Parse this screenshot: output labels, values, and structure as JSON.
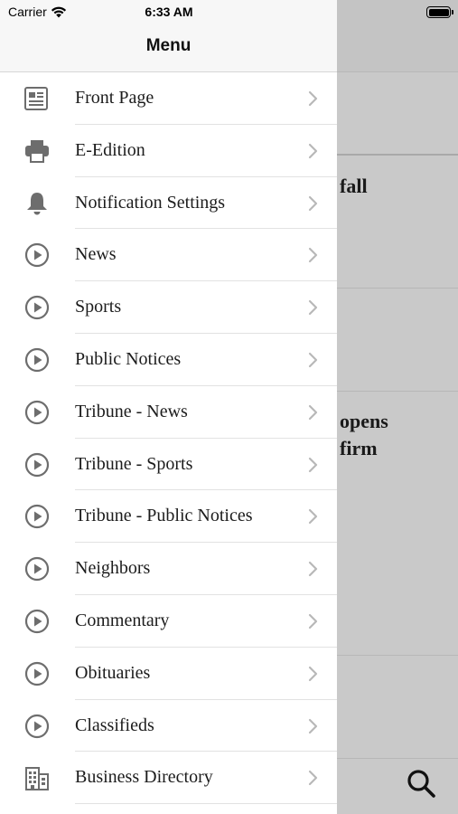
{
  "status_bar": {
    "carrier": "Carrier",
    "time": "6:33 AM"
  },
  "menu": {
    "title": "Menu",
    "items": [
      {
        "label": "Front Page",
        "icon": "newspaper-icon"
      },
      {
        "label": "E-Edition",
        "icon": "printer-icon"
      },
      {
        "label": "Notification Settings",
        "icon": "bell-icon"
      },
      {
        "label": "News",
        "icon": "play-circle-icon"
      },
      {
        "label": "Sports",
        "icon": "play-circle-icon"
      },
      {
        "label": "Public Notices",
        "icon": "play-circle-icon"
      },
      {
        "label": "Tribune - News",
        "icon": "play-circle-icon"
      },
      {
        "label": "Tribune - Sports",
        "icon": "play-circle-icon"
      },
      {
        "label": "Tribune - Public Notices",
        "icon": "play-circle-icon"
      },
      {
        "label": "Neighbors",
        "icon": "play-circle-icon"
      },
      {
        "label": "Commentary",
        "icon": "play-circle-icon"
      },
      {
        "label": "Obituaries",
        "icon": "play-circle-icon"
      },
      {
        "label": "Classifieds",
        "icon": "play-circle-icon"
      },
      {
        "label": "Business Directory",
        "icon": "building-icon"
      }
    ]
  },
  "background": {
    "headline_1": "fall",
    "headline_2_line_1": "opens",
    "headline_2_line_2": "firm",
    "search_icon": "search-icon"
  },
  "colors": {
    "menu_background": "#ffffff",
    "header_background": "#f7f7f7",
    "dim_overlay": "#c9c9c9",
    "icon_gray": "#6d6d6d"
  }
}
